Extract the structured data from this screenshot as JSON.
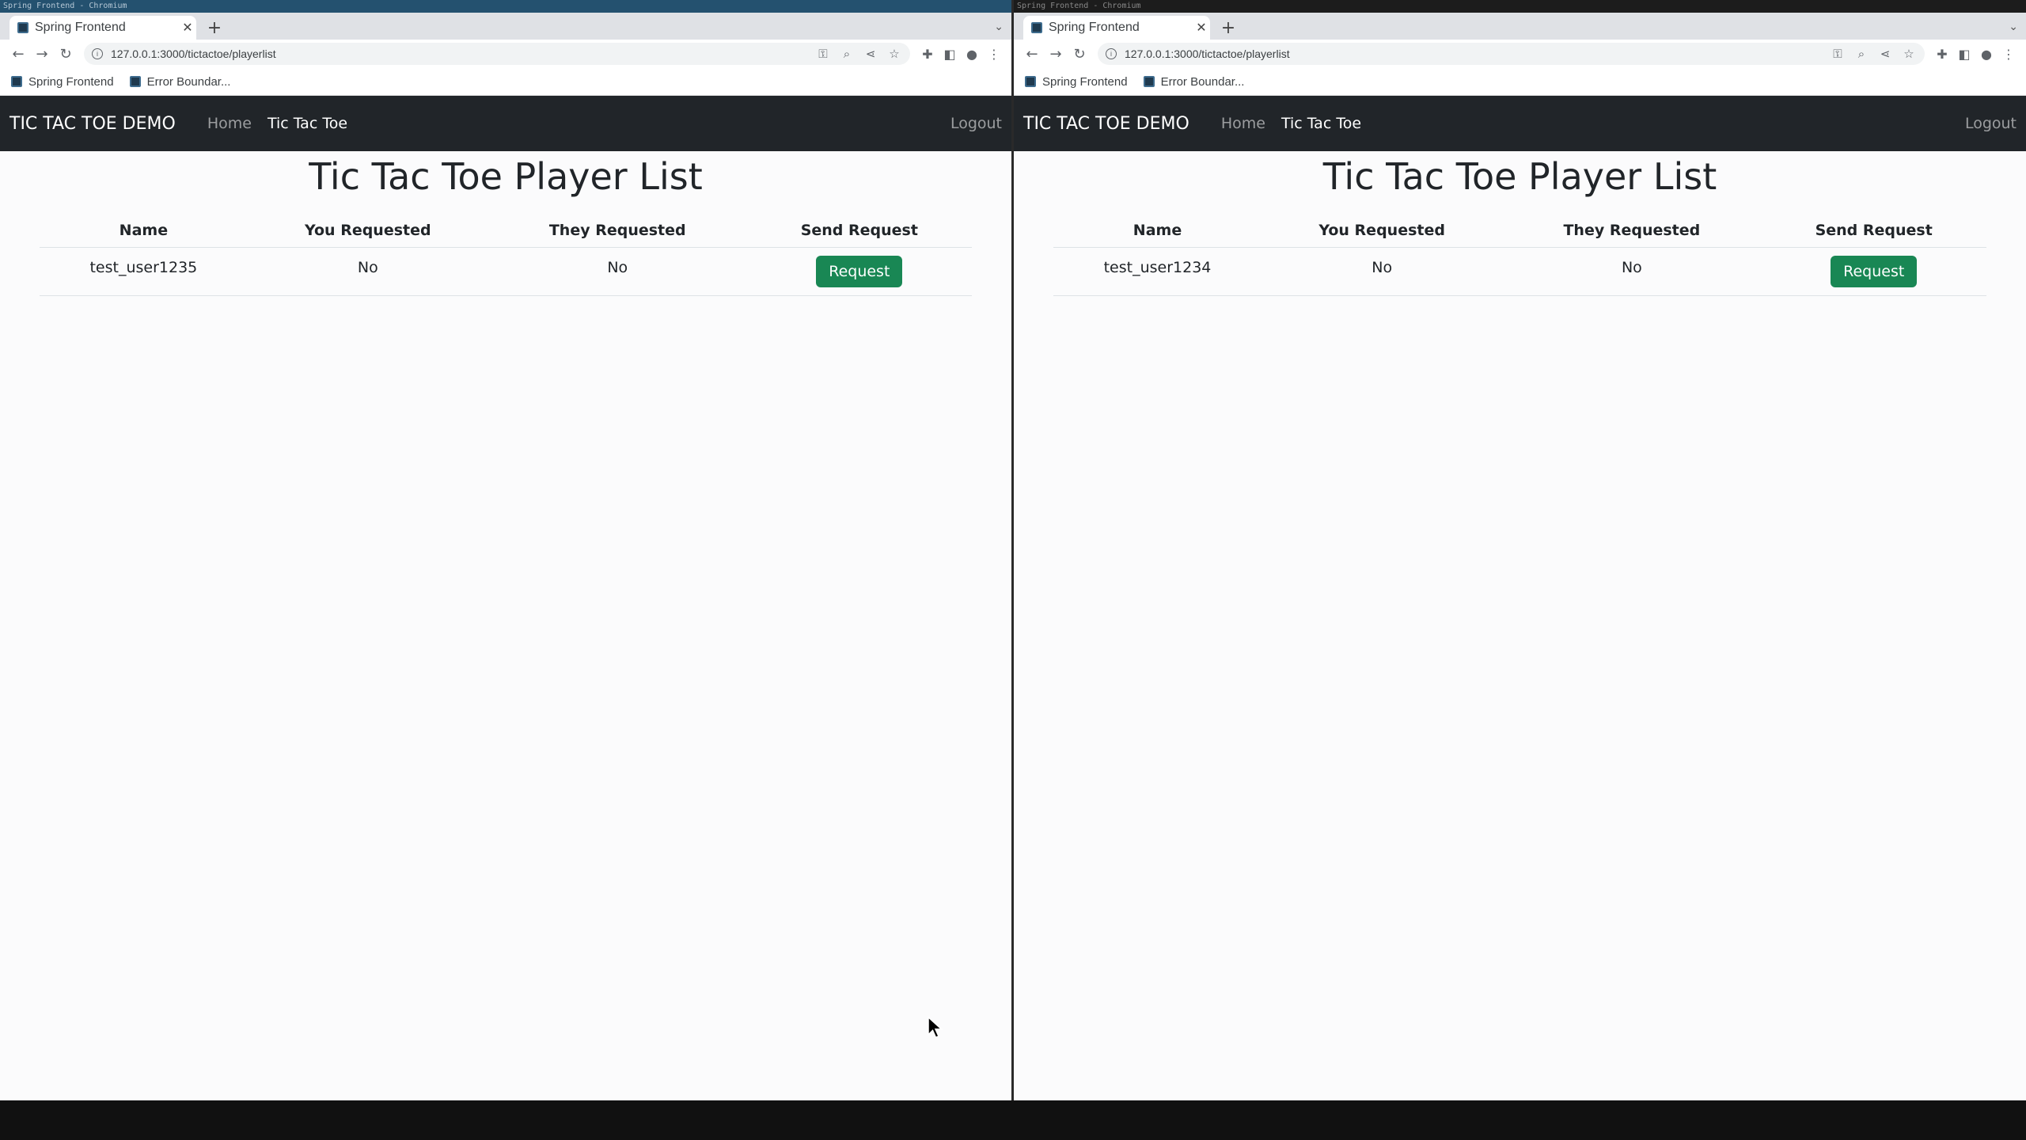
{
  "windows": [
    {
      "os_title": "Spring Frontend - Chromium",
      "tab_title": "Spring Frontend",
      "url": "127.0.0.1:3000/tictactoe/playerlist",
      "bookmarks": [
        "Spring Frontend",
        "Error Boundar..."
      ],
      "nav": {
        "brand": "TIC TAC TOE DEMO",
        "links": [
          "Home",
          "Tic Tac Toe"
        ],
        "logout": "Logout"
      },
      "page_title": "Tic Tac Toe Player List",
      "table": {
        "headers": [
          "Name",
          "You Requested",
          "They Requested",
          "Send Request"
        ],
        "rows": [
          {
            "name": "test_user1235",
            "you_requested": "No",
            "they_requested": "No",
            "action": "Request"
          }
        ]
      }
    },
    {
      "os_title": "Spring Frontend - Chromium",
      "tab_title": "Spring Frontend",
      "url": "127.0.0.1:3000/tictactoe/playerlist",
      "bookmarks": [
        "Spring Frontend",
        "Error Boundar..."
      ],
      "nav": {
        "brand": "TIC TAC TOE DEMO",
        "links": [
          "Home",
          "Tic Tac Toe"
        ],
        "logout": "Logout"
      },
      "page_title": "Tic Tac Toe Player List",
      "table": {
        "headers": [
          "Name",
          "You Requested",
          "They Requested",
          "Send Request"
        ],
        "rows": [
          {
            "name": "test_user1234",
            "you_requested": "No",
            "they_requested": "No",
            "action": "Request"
          }
        ]
      }
    }
  ],
  "colors": {
    "navbar": "#212529",
    "request_button": "#198754",
    "page_background": "#fbfbfc"
  }
}
